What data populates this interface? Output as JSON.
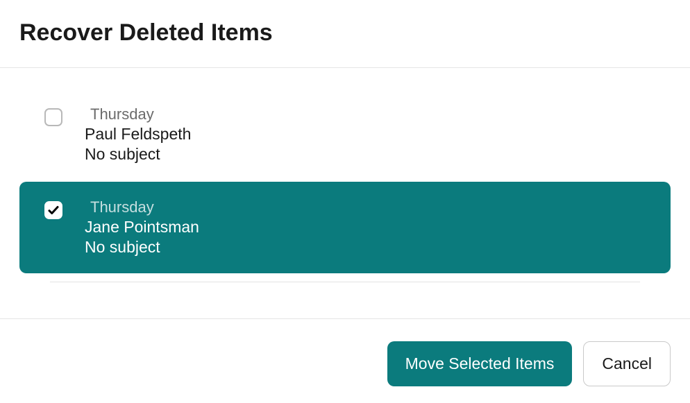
{
  "header": {
    "title": "Recover Deleted Items"
  },
  "items": [
    {
      "day": "Thursday",
      "sender": "Paul Feldspeth",
      "subject": "No subject",
      "selected": false
    },
    {
      "day": "Thursday",
      "sender": "Jane Pointsman",
      "subject": "No subject",
      "selected": true
    }
  ],
  "footer": {
    "move_label": "Move Selected Items",
    "cancel_label": "Cancel"
  },
  "colors": {
    "accent": "#0b7b7d"
  }
}
